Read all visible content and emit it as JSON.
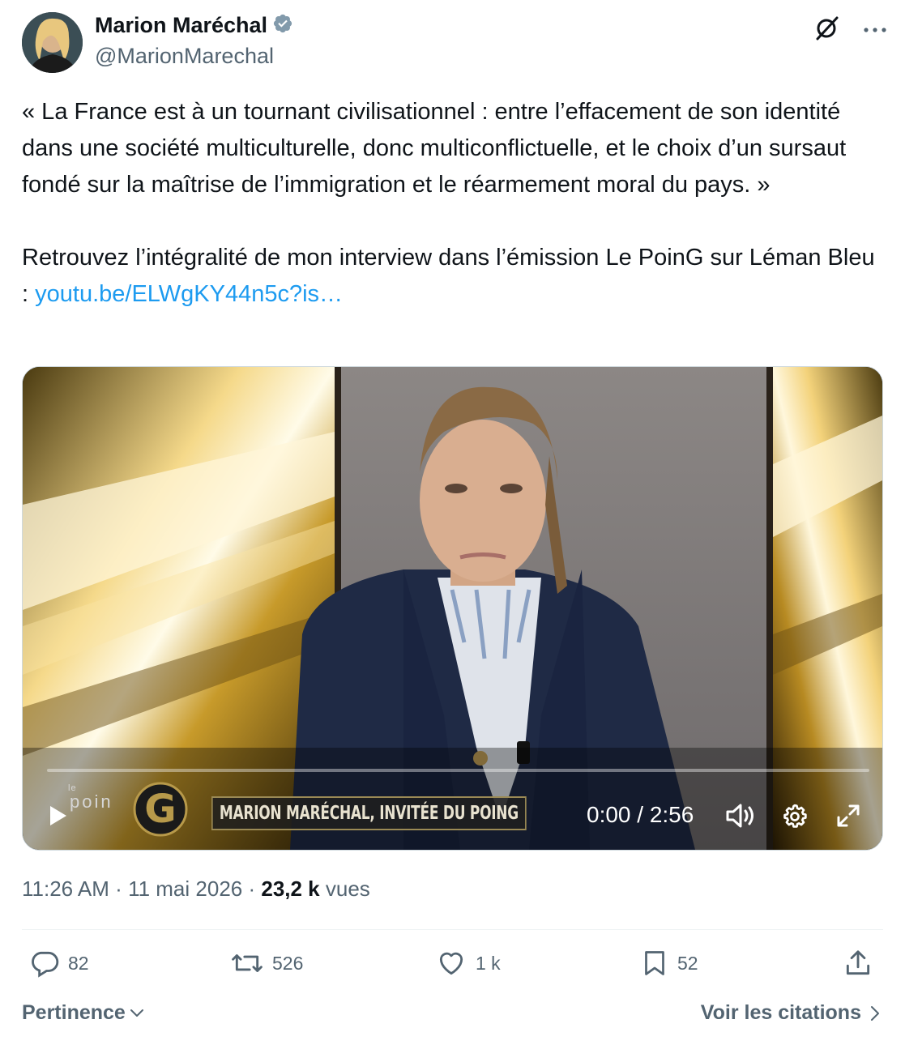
{
  "author": {
    "name": "Marion Maréchal",
    "handle": "@MarionMarechal",
    "verified_color": "#829aab"
  },
  "tweet": {
    "text": "« La France est à un tournant civilisationnel : entre l’effacement de son identité dans une société multiculturelle, donc multiconflictuelle, et le choix d’un sursaut fondé sur la maîtrise de l’immigration et le réarmement moral du pays. »\n\nRetrouvez l’intégralité de mon interview dans l’émission Le PoinG sur Léman Bleu : ",
    "link": "youtu.be/ELWgKY44n5c?is…",
    "link_color": "#1d9bf0"
  },
  "video": {
    "logo_small": "le",
    "logo_text": "poin",
    "logo_letter": "G",
    "lower_third": "MARION MARÉCHAL, INVITÉE DU POING",
    "timecode": "0:00 / 2:56",
    "progress": 0
  },
  "meta": {
    "time": "11:26 AM",
    "date": "11 mai 2026",
    "views": "23,2 k",
    "views_label": "vues"
  },
  "actions": {
    "replies": "82",
    "reposts": "526",
    "likes": "1 k",
    "bookmarks": "52"
  },
  "footer": {
    "sort_label": "Pertinence",
    "quotes_label": "Voir les citations"
  }
}
